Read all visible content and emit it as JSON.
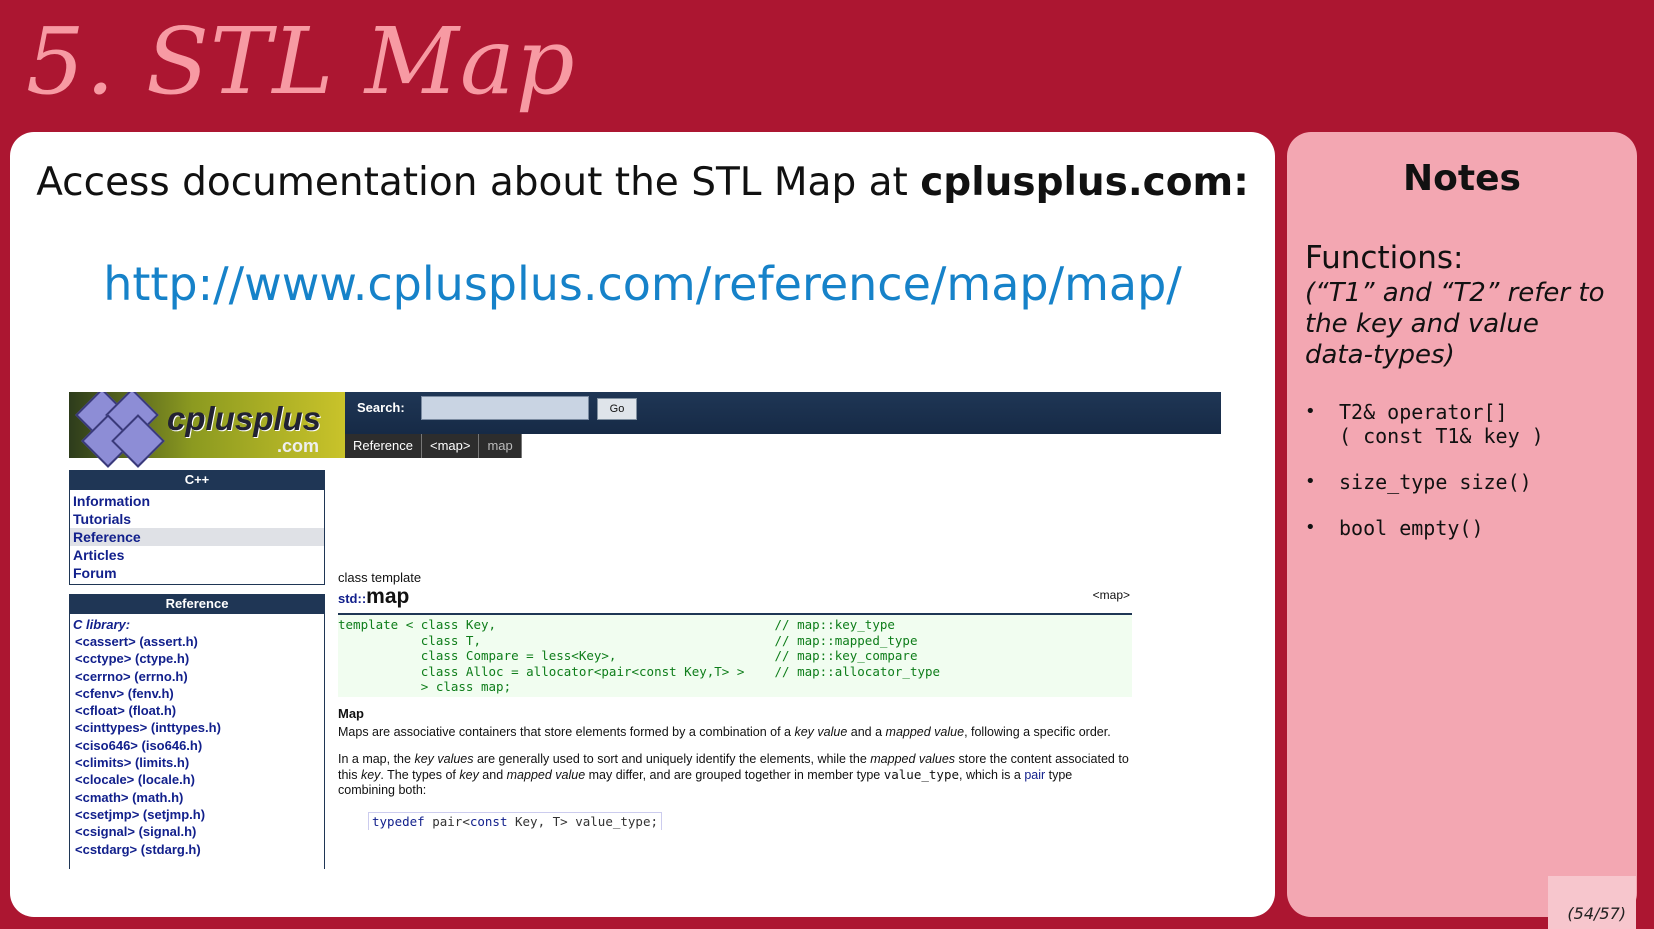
{
  "slide": {
    "title": "5. STL Map",
    "headline_prefix": "Access documentation about the STL Map at ",
    "headline_bold": "cplusplus.com:",
    "link": "http://www.cplusplus.com/reference/map/map/",
    "page": "(54/57)"
  },
  "site": {
    "logo_text": "cplusplus",
    "logo_domain": ".com",
    "search_label": "Search:",
    "search_value": "",
    "go_label": "Go",
    "breadcrumbs": [
      "Reference",
      "<map>",
      "map"
    ],
    "nav_header": "C++",
    "nav_items": [
      "Information",
      "Tutorials",
      "Reference",
      "Articles",
      "Forum"
    ],
    "ref_header": "Reference",
    "lib_title": "C library:",
    "lib_items": [
      "<cassert> (assert.h)",
      "<cctype> (ctype.h)",
      "<cerrno> (errno.h)",
      "<cfenv> (fenv.h)",
      "<cfloat> (float.h)",
      "<cinttypes> (inttypes.h)",
      "<ciso646> (iso646.h)",
      "<climits> (limits.h)",
      "<clocale> (locale.h)",
      "<cmath> (math.h)",
      "<csetjmp> (setjmp.h)",
      "<csignal> (signal.h)",
      "<cstdarg> (stdarg.h)"
    ],
    "content": {
      "class_template": "class template",
      "namespace": "std::",
      "name": "map",
      "header_tag": "<map>",
      "code_lines": [
        "template < class Key,                                     // map::key_type",
        "           class T,                                       // map::mapped_type",
        "           class Compare = less<Key>,                     // map::key_compare",
        "           class Alloc = allocator<pair<const Key,T> >    // map::allocator_type",
        "           > class map;"
      ],
      "section_title": "Map",
      "para1_a": "Maps are associative containers that store elements formed by a combination of a ",
      "para1_b": "key value",
      "para1_c": " and a ",
      "para1_d": "mapped value",
      "para1_e": ", following a specific order.",
      "para2_a": "In a map, the ",
      "para2_b": "key values",
      "para2_c": " are generally used to sort and uniquely identify the elements, while the ",
      "para2_d": "mapped values",
      "para2_e": " store the content associated to this ",
      "para2_f": "key",
      "para2_g": ". The types of ",
      "para2_h": "key",
      "para2_i": " and ",
      "para2_j": "mapped value",
      "para2_k": " may differ, and are grouped together in member type ",
      "para2_l": "value_type",
      "para2_m": ", which is a ",
      "para2_n": "pair",
      "para2_o": " type combining both:",
      "typedef_kw": "typedef",
      "typedef_a": " pair<",
      "typedef_kw2": "const",
      "typedef_b": " Key, T> value_type;"
    }
  },
  "notes": {
    "title": "Notes",
    "subtitle": "Functions:",
    "note": "(“T1” and “T2” refer to the key and value data-types)",
    "functions": [
      "T2& operator[]\n( const T1& key )",
      "size_type size()",
      "bool empty()"
    ]
  }
}
